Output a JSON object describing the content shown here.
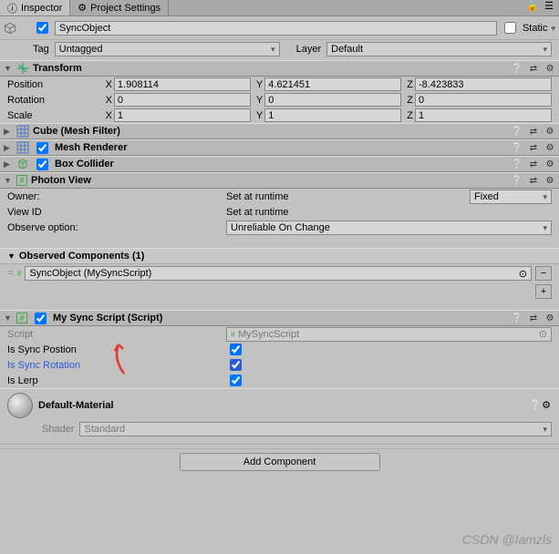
{
  "tabs": {
    "inspector": "Inspector",
    "project_settings": "Project Settings"
  },
  "header": {
    "name": "SyncObject",
    "static_label": "Static",
    "tag_label": "Tag",
    "tag_value": "Untagged",
    "layer_label": "Layer",
    "layer_value": "Default"
  },
  "transform": {
    "title": "Transform",
    "position_label": "Position",
    "rotation_label": "Rotation",
    "scale_label": "Scale",
    "x": "X",
    "y": "Y",
    "z": "Z",
    "pos": {
      "x": "1.908114",
      "y": "4.621451",
      "z": "-8.423833"
    },
    "rot": {
      "x": "0",
      "y": "0",
      "z": "0"
    },
    "scl": {
      "x": "1",
      "y": "1",
      "z": "1"
    }
  },
  "components": {
    "mesh_filter": "Cube (Mesh Filter)",
    "mesh_renderer": "Mesh Renderer",
    "box_collider": "Box Collider",
    "photon_view": "Photon View"
  },
  "photon": {
    "owner_label": "Owner:",
    "owner_value": "Set at runtime",
    "owner_mode": "Fixed",
    "viewid_label": "View ID",
    "viewid_value": "Set at runtime",
    "observe_label": "Observe option:",
    "observe_value": "Unreliable On Change",
    "obs_header": "Observed Components (1)",
    "obs_item": "SyncObject (MySyncScript)"
  },
  "script_comp": {
    "title": "My Sync Script (Script)",
    "script_label": "Script",
    "script_value": "MySyncScript",
    "is_sync_pos": "Is Sync Postion",
    "is_sync_rot": "Is Sync Rotation",
    "is_lerp": "Is Lerp"
  },
  "material": {
    "name": "Default-Material",
    "shader_label": "Shader",
    "shader_value": "Standard"
  },
  "footer": {
    "add_component": "Add Component"
  },
  "watermark": "CSDN @Iamzls"
}
